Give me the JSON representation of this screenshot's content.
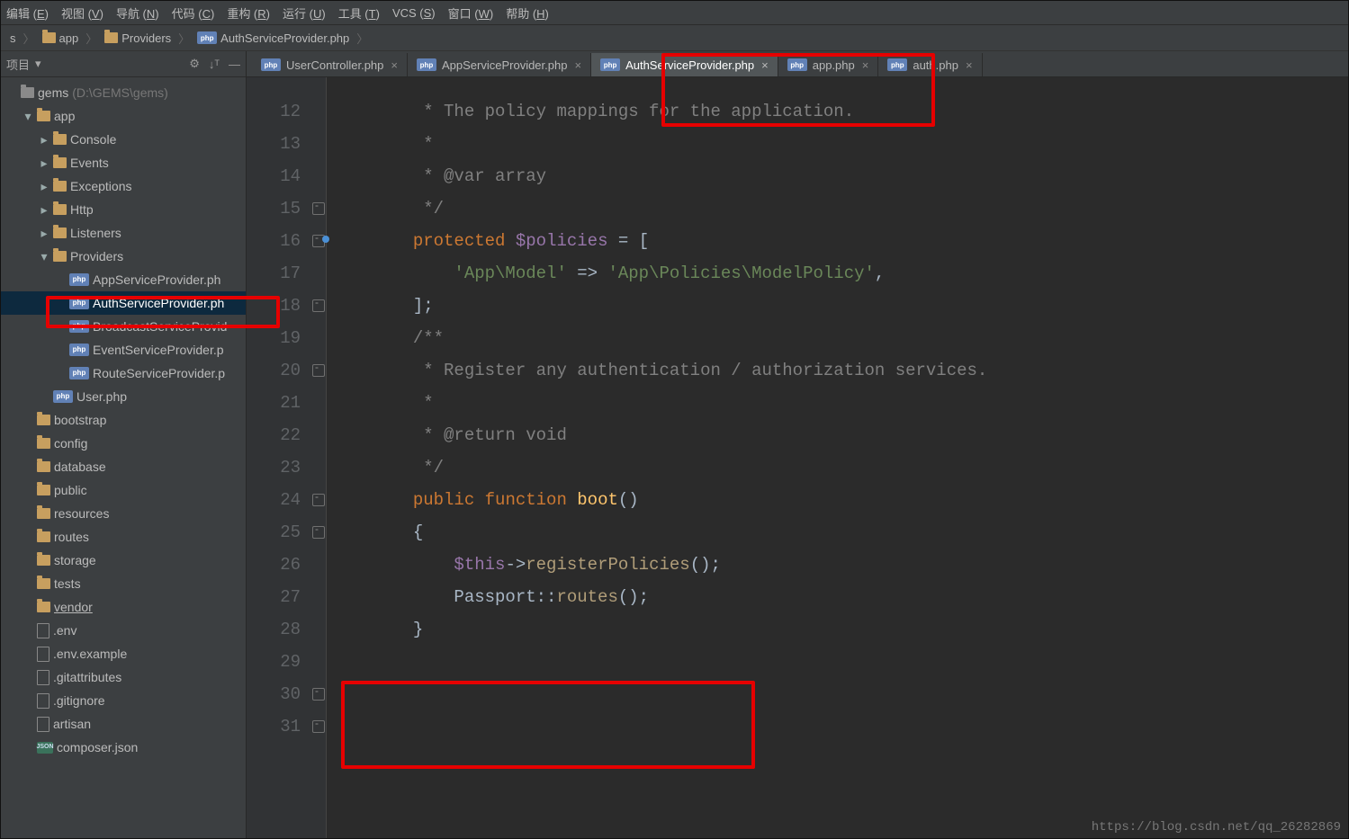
{
  "menu": {
    "items": [
      {
        "t": "编辑",
        "k": "E"
      },
      {
        "t": "视图",
        "k": "V"
      },
      {
        "t": "导航",
        "k": "N"
      },
      {
        "t": "代码",
        "k": "C"
      },
      {
        "t": "重构",
        "k": "R"
      },
      {
        "t": "运行",
        "k": "U"
      },
      {
        "t": "工具",
        "k": "T"
      },
      {
        "t": "VCS",
        "k": "S"
      },
      {
        "t": "窗口",
        "k": "W"
      },
      {
        "t": "帮助",
        "k": "H"
      }
    ]
  },
  "breadcrumb": [
    {
      "kind": "txt",
      "label": "s"
    },
    {
      "kind": "folder",
      "label": "app"
    },
    {
      "kind": "folder",
      "label": "Providers"
    },
    {
      "kind": "php",
      "label": "AuthServiceProvider.php"
    }
  ],
  "panel": {
    "title": "项目",
    "hide": "—"
  },
  "tree": [
    {
      "d": 0,
      "arrow": "blank",
      "icon": "folder-grey",
      "label": "gems",
      "suffix": " (D:\\GEMS\\gems)"
    },
    {
      "d": 1,
      "arrow": "down",
      "icon": "folder",
      "label": "app"
    },
    {
      "d": 2,
      "arrow": "right",
      "icon": "folder",
      "label": "Console"
    },
    {
      "d": 2,
      "arrow": "right",
      "icon": "folder",
      "label": "Events"
    },
    {
      "d": 2,
      "arrow": "right",
      "icon": "folder",
      "label": "Exceptions"
    },
    {
      "d": 2,
      "arrow": "right",
      "icon": "folder",
      "label": "Http"
    },
    {
      "d": 2,
      "arrow": "right",
      "icon": "folder",
      "label": "Listeners"
    },
    {
      "d": 2,
      "arrow": "down",
      "icon": "folder",
      "label": "Providers"
    },
    {
      "d": 3,
      "arrow": "blank",
      "icon": "php",
      "label": "AppServiceProvider.ph"
    },
    {
      "d": 3,
      "arrow": "blank",
      "icon": "php",
      "label": "AuthServiceProvider.ph",
      "sel": true
    },
    {
      "d": 3,
      "arrow": "blank",
      "icon": "php",
      "label": "BroadcastServiceProvid"
    },
    {
      "d": 3,
      "arrow": "blank",
      "icon": "php",
      "label": "EventServiceProvider.p"
    },
    {
      "d": 3,
      "arrow": "blank",
      "icon": "php",
      "label": "RouteServiceProvider.p"
    },
    {
      "d": 2,
      "arrow": "blank",
      "icon": "php",
      "label": "User.php"
    },
    {
      "d": 1,
      "arrow": "blank",
      "icon": "folder",
      "label": "bootstrap"
    },
    {
      "d": 1,
      "arrow": "blank",
      "icon": "folder",
      "label": "config"
    },
    {
      "d": 1,
      "arrow": "blank",
      "icon": "folder",
      "label": "database"
    },
    {
      "d": 1,
      "arrow": "blank",
      "icon": "folder",
      "label": "public"
    },
    {
      "d": 1,
      "arrow": "blank",
      "icon": "folder",
      "label": "resources"
    },
    {
      "d": 1,
      "arrow": "blank",
      "icon": "folder",
      "label": "routes"
    },
    {
      "d": 1,
      "arrow": "blank",
      "icon": "folder",
      "label": "storage"
    },
    {
      "d": 1,
      "arrow": "blank",
      "icon": "folder",
      "label": "tests"
    },
    {
      "d": 1,
      "arrow": "blank",
      "icon": "folder",
      "label": "vendor",
      "underline": true
    },
    {
      "d": 1,
      "arrow": "blank",
      "icon": "file",
      "label": ".env"
    },
    {
      "d": 1,
      "arrow": "blank",
      "icon": "file",
      "label": ".env.example"
    },
    {
      "d": 1,
      "arrow": "blank",
      "icon": "file",
      "label": ".gitattributes"
    },
    {
      "d": 1,
      "arrow": "blank",
      "icon": "file",
      "label": ".gitignore"
    },
    {
      "d": 1,
      "arrow": "blank",
      "icon": "file",
      "label": "artisan"
    },
    {
      "d": 1,
      "arrow": "blank",
      "icon": "json",
      "label": "composer.json"
    }
  ],
  "tabs": [
    {
      "label": "UserController.php",
      "active": false
    },
    {
      "label": "AppServiceProvider.php",
      "active": false
    },
    {
      "label": "AuthServiceProvider.php",
      "active": true
    },
    {
      "label": "app.php",
      "active": false
    },
    {
      "label": "auth.php",
      "active": false
    }
  ],
  "code": {
    "startLine": 12,
    "lines": [
      {
        "html": "        <span class='c-cmt'>* The policy mappings for the application.</span>"
      },
      {
        "html": "        <span class='c-cmt'>*</span>"
      },
      {
        "html": "        <span class='c-cmt'>* @var array</span>"
      },
      {
        "html": "        <span class='c-cmt'>*/</span>"
      },
      {
        "html": "       <span class='c-kw'>protected</span> <span class='c-var'>$policies</span> = ["
      },
      {
        "html": "           <span class='c-str'>'App\\Model'</span> =&gt; <span class='c-str'>'App\\Policies\\ModelPolicy'</span>,"
      },
      {
        "html": "       ];"
      },
      {
        "html": ""
      },
      {
        "html": "       <span class='c-cmt'>/**</span>"
      },
      {
        "html": "        <span class='c-cmt'>* Register any authentication / authorization services.</span>"
      },
      {
        "html": "        <span class='c-cmt'>*</span>"
      },
      {
        "html": "        <span class='c-cmt'>* @return void</span>"
      },
      {
        "html": "        <span class='c-cmt'>*/</span>"
      },
      {
        "html": "       <span class='c-kw'>public function</span> <span class='c-func'>boot</span>()"
      },
      {
        "html": "       {"
      },
      {
        "html": "           <span class='c-var'>$this</span>-&gt;<span class='c-call'>registerPolicies</span>();"
      },
      {
        "html": ""
      },
      {
        "html": "           <span class='c-id'>Passport</span>::<span class='c-call'>routes</span>();"
      },
      {
        "html": "       }"
      },
      {
        "html": ""
      }
    ],
    "foldRows": [
      3,
      4,
      6,
      8,
      12,
      13,
      18,
      19
    ]
  },
  "closeGlyph": "×",
  "phpBadge": "php",
  "jsonBadge": "JSON",
  "watermark": "https://blog.csdn.net/qq_26282869"
}
